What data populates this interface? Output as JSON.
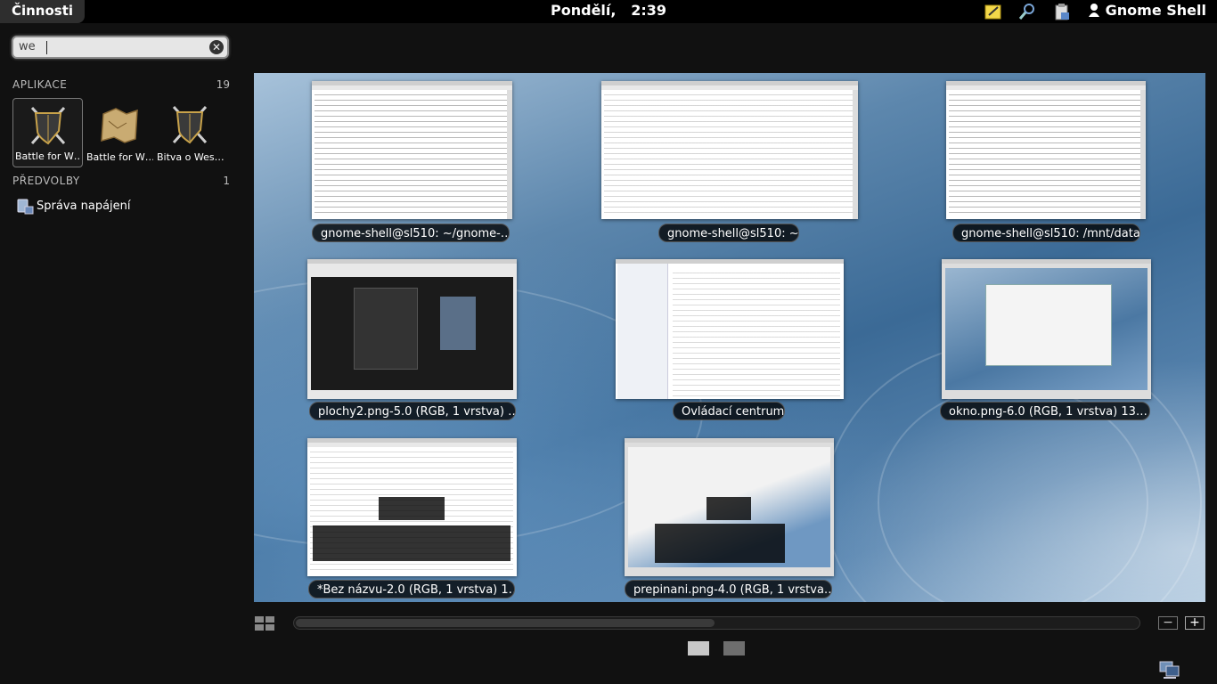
{
  "panel": {
    "activities": "Činnosti",
    "day": "Pondělí,",
    "time": "2:39",
    "user": "Gnome Shell"
  },
  "search": {
    "value": "we"
  },
  "sidebar": {
    "apps_title": "APLIKACE",
    "apps_count": "19",
    "apps": [
      {
        "label": "Battle for W…"
      },
      {
        "label": "Battle for W…"
      },
      {
        "label": "Bitva o Wes…"
      }
    ],
    "prefs_title": "PŘEDVOLBY",
    "prefs_count": "1",
    "prefs": [
      {
        "label": "Správa napájení"
      }
    ]
  },
  "windows": [
    {
      "title": "gnome-shell@sl510: ~/gnome-…"
    },
    {
      "title": "gnome-shell@sl510: ~"
    },
    {
      "title": "gnome-shell@sl510: /mnt/data"
    },
    {
      "title": "plochy2.png-5.0 (RGB, 1 vrstva) …"
    },
    {
      "title": "Ovládací centrum"
    },
    {
      "title": "okno.png-6.0 (RGB, 1 vrstva) 13…"
    },
    {
      "title": "*Bez názvu-2.0 (RGB, 1 vrstva) 1…"
    },
    {
      "title": "prepinani.png-4.0 (RGB, 1 vrstva…"
    }
  ],
  "zoom": {
    "minus": "−",
    "plus": "+"
  },
  "colors": {
    "panel_bg": "#000000",
    "overview_bg": "#111111",
    "workspace_blue": "#3b6a96"
  }
}
